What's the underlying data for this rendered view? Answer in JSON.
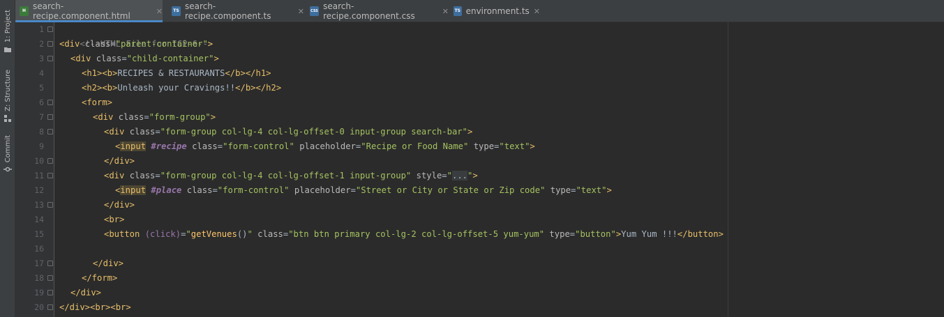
{
  "side_tabs": [
    {
      "label": "1: Project",
      "icon": "folder-icon"
    },
    {
      "label": "Z: Structure",
      "icon": "structure-icon"
    },
    {
      "label": "Commit",
      "icon": "commit-icon"
    }
  ],
  "tabs": [
    {
      "name": "search-recipe.component.html",
      "type": "H",
      "color": "#3c7a3c",
      "active": true
    },
    {
      "name": "search-recipe.component.ts",
      "type": "TS",
      "color": "#3d6e9e",
      "active": false
    },
    {
      "name": "search-recipe.component.css",
      "type": "CSS",
      "color": "#3d6e9e",
      "active": false
    },
    {
      "name": "environment.ts",
      "type": "TS",
      "color": "#3d6e9e",
      "active": false
    }
  ],
  "tab_close_glyph": "✕",
  "line_numbers": [
    "1",
    "2",
    "3",
    "4",
    "5",
    "6",
    "7",
    "8",
    "9",
    "10",
    "11",
    "12",
    "13",
    "14",
    "15",
    "16",
    "17",
    "18",
    "19",
    "20"
  ],
  "code": {
    "l1": "<!--HTML File for ICP-6-->",
    "l2_open": "<div ",
    "l2_attr": "class",
    "l2_eq": "=",
    "l2_val": "\"parent-container\"",
    "l2_close": ">",
    "l3_open": "<div ",
    "l3_attr": "class",
    "l3_eq": "=",
    "l3_val": "\"child-container\"",
    "l3_close": ">",
    "l4_tag1": "<h1><b>",
    "l4_text": "RECIPES & RESTAURANTS",
    "l4_tag2": "</b></h1>",
    "l5_tag1": "<h2><b>",
    "l5_text": "Unleash your Cravings!!",
    "l5_tag2": "</b></h2>",
    "l6": "<form>",
    "l7_open": "<div ",
    "l7_attr": "class",
    "l7_eq": "=",
    "l7_val": "\"form-group\"",
    "l7_close": ">",
    "l8_open": "<div ",
    "l8_attr": "class",
    "l8_eq": "=",
    "l8_val": "\"form-group col-lg-4 col-lg-offset-0 input-group search-bar\"",
    "l8_close": ">",
    "l9_lt": "<",
    "l9_input": "input",
    "l9_sp": " ",
    "l9_ref": "#recipe",
    "l9_attr1": " class",
    "l9_eq1": "=",
    "l9_val1": "\"form-control\"",
    "l9_attr2": " placeholder",
    "l9_eq2": "=",
    "l9_val2": "\"Recipe or Food Name\"",
    "l9_attr3": " type",
    "l9_eq3": "=",
    "l9_val3": "\"text\"",
    "l9_close": ">",
    "l10": "</div>",
    "l11_open": "<div ",
    "l11_attr1": "class",
    "l11_eq1": "=",
    "l11_val1": "\"form-group col-lg-4 col-lg-offset-1 input-group\"",
    "l11_attr2": " style",
    "l11_eq2": "=",
    "l11_q1": "\"",
    "l11_fold": "...",
    "l11_q2": "\"",
    "l11_close": ">",
    "l12_lt": "<",
    "l12_input": "input",
    "l12_sp": " ",
    "l12_ref": "#place",
    "l12_attr1": " class",
    "l12_eq1": "=",
    "l12_val1": "\"form-control\"",
    "l12_attr2": " placeholder",
    "l12_eq2": "=",
    "l12_val2": "\"Street or City or State or Zip code\"",
    "l12_attr3": " type",
    "l12_eq3": "=",
    "l12_val3": "\"text\"",
    "l12_close": ">",
    "l13": "</div>",
    "l14": "<br>",
    "l15_open": "<button ",
    "l15_event": "(click)",
    "l15_eq1": "=",
    "l15_q1": "\"",
    "l15_func": "getVenues",
    "l15_paren": "()",
    "l15_q2": "\"",
    "l15_attr2": " class",
    "l15_eq2": "=",
    "l15_val2": "\"btn btn primary col-lg-2 col-lg-offset-5 yum-yum\"",
    "l15_attr3": " type",
    "l15_eq3": "=",
    "l15_val3": "\"button\"",
    "l15_gt": ">",
    "l15_text": "Yum Yum !!!",
    "l15_close": "</button>",
    "l17": "</div>",
    "l18": "</form>",
    "l19": "</div>",
    "l20": "</div><br><br>"
  },
  "colors": {
    "tag": "#e8bf6a",
    "attribute": "#bababa",
    "value": "#a5c261",
    "comment": "#808080",
    "reference": "#9876aa",
    "function": "#ffc66d",
    "active_tab_underline": "#4a88c7"
  }
}
